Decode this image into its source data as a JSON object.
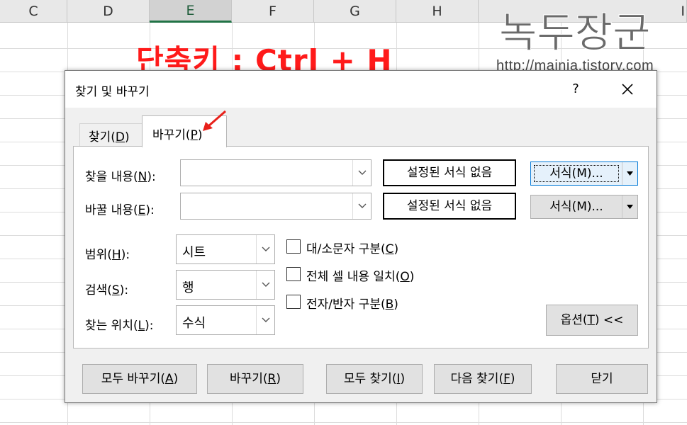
{
  "sheet": {
    "columns": [
      "C",
      "D",
      "E",
      "F",
      "G",
      "H",
      "I"
    ],
    "selected_column": "E"
  },
  "overlay": {
    "shortcut_text": "단축키 : Ctrl + H",
    "shortcut_color": "#ff1a1a",
    "brand_logo": "녹두장군",
    "brand_url": "http://mainia.tistory.com"
  },
  "dialog": {
    "title": "찾기 및 바꾸기",
    "help_label": "?",
    "tabs": {
      "find": {
        "label": "찾기",
        "key": "D"
      },
      "replace": {
        "label": "바꾸기",
        "key": "P"
      }
    },
    "find_what": {
      "label": "찾을 내용",
      "key": "N",
      "value": "",
      "format_preview": "설정된 서식 없음"
    },
    "replace_with": {
      "label": "바꿀 내용",
      "key": "E",
      "value": "",
      "format_preview": "설정된 서식 없음"
    },
    "format_button_1": "서식(M)...",
    "format_button_2": "서식(M)...",
    "within": {
      "label": "범위",
      "key": "H",
      "value": "시트"
    },
    "search": {
      "label": "검색",
      "key": "S",
      "value": "행"
    },
    "look_in": {
      "label": "찾는 위치",
      "key": "L",
      "value": "수식"
    },
    "options": [
      {
        "label": "대/소문자 구분",
        "key": "C",
        "checked": false
      },
      {
        "label": "전체 셀 내용 일치",
        "key": "O",
        "checked": false
      },
      {
        "label": "전자/반자 구분",
        "key": "B",
        "checked": false
      }
    ],
    "options_button": {
      "label": "옵션",
      "key": "T",
      "suffix": " <<"
    },
    "buttons": {
      "replace_all": {
        "label": "모두 바꾸기",
        "key": "A"
      },
      "replace": {
        "label": "바꾸기",
        "key": "R"
      },
      "find_all": {
        "label": "모두 찾기",
        "key": "I"
      },
      "find_next": {
        "label": "다음 찾기",
        "key": "F"
      },
      "close": {
        "label": "닫기"
      }
    },
    "accent_color": "#0078d7",
    "arrow_annotation_color": "#e8201a"
  }
}
